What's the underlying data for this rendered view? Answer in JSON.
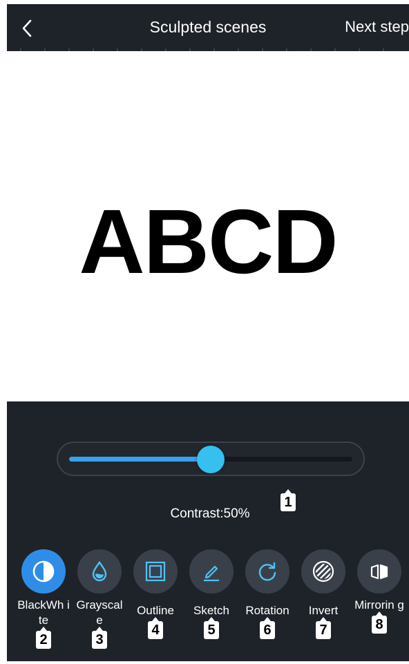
{
  "header": {
    "title": "Sculpted scenes",
    "next_label": "Next step",
    "back_icon": "chevron-left-icon"
  },
  "canvas": {
    "preview_text": "ABCD"
  },
  "slider": {
    "name": "Contrast",
    "value_percent": 50,
    "label": "Contrast:50%",
    "accent_color": "#3aa0f0",
    "thumb_color": "#35c0f0"
  },
  "tools": [
    {
      "label": "BlackWh ite",
      "icon": "contrast-circle-icon",
      "active": true,
      "callout": "2"
    },
    {
      "label": "Grayscal e",
      "icon": "droplet-icon",
      "active": false,
      "callout": "3"
    },
    {
      "label": "Outline",
      "icon": "square-outline-icon",
      "active": false,
      "callout": "4"
    },
    {
      "label": "Sketch",
      "icon": "pencil-icon",
      "active": false,
      "callout": "5"
    },
    {
      "label": "Rotation",
      "icon": "rotate-icon",
      "active": false,
      "callout": "6"
    },
    {
      "label": "Invert",
      "icon": "stripes-circle-icon",
      "active": false,
      "callout": "7"
    },
    {
      "label": "Mirrorin g",
      "icon": "mirror-icon",
      "active": false,
      "callout": "8"
    }
  ],
  "callouts": {
    "slider": "1"
  },
  "colors": {
    "background": "#1e2329",
    "button": "#3a4049",
    "active_button": "#2f8de8",
    "icon": "#4fc3f7"
  }
}
